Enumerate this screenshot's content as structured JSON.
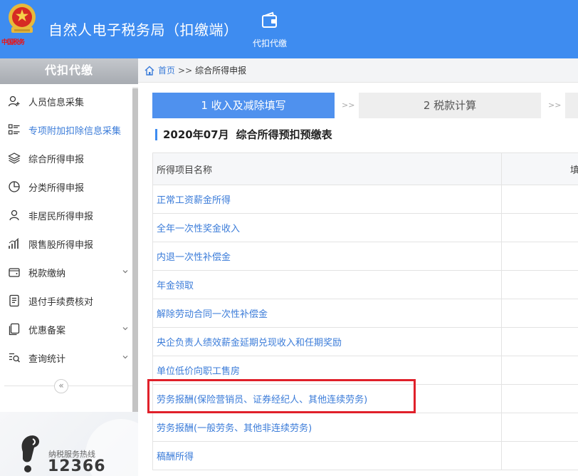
{
  "header": {
    "title": "自然人电子税务局（扣缴端）",
    "emblem_caption": "中国税务",
    "nav": [
      {
        "label": "代扣代缴",
        "icon": "wallet-icon"
      }
    ]
  },
  "sidebar": {
    "title": "代扣代缴",
    "items": [
      {
        "label": "人员信息采集",
        "icon": "person-add-icon",
        "expandable": false
      },
      {
        "label": "专项附加扣除信息采集",
        "icon": "list-icon",
        "expandable": false,
        "active": true
      },
      {
        "label": "综合所得申报",
        "icon": "layers-icon",
        "expandable": false
      },
      {
        "label": "分类所得申报",
        "icon": "pie-chart-icon",
        "expandable": false
      },
      {
        "label": "非居民所得申报",
        "icon": "person-icon",
        "expandable": false
      },
      {
        "label": "限售股所得申报",
        "icon": "bar-chart-icon",
        "expandable": false
      },
      {
        "label": "税款缴纳",
        "icon": "wallet-icon",
        "expandable": true
      },
      {
        "label": "退付手续费核对",
        "icon": "document-icon",
        "expandable": false
      },
      {
        "label": "优惠备案",
        "icon": "copy-icon",
        "expandable": true
      },
      {
        "label": "查询统计",
        "icon": "search-list-icon",
        "expandable": true
      }
    ],
    "collapse_glyph": "«",
    "hotline": {
      "label": "纳税服务热线",
      "number": "12366"
    }
  },
  "breadcrumb": {
    "home": "首页",
    "separator": ">>",
    "current": "综合所得申报"
  },
  "steps": [
    {
      "label": "1 收入及减除填写",
      "active": true
    },
    {
      "label": "2 税款计算",
      "active": false
    },
    {
      "label": "",
      "active": false
    }
  ],
  "step_separator": ">>",
  "section": {
    "period": "2020年07月",
    "title": "综合所得预扣预缴表"
  },
  "table": {
    "headers": {
      "name": "所得项目名称",
      "fill": "填"
    },
    "rows": [
      "正常工资薪金所得",
      "全年一次性奖金收入",
      "内退一次性补偿金",
      "年金领取",
      "解除劳动合同一次性补偿金",
      "央企负责人绩效薪金延期兑现收入和任期奖励",
      "单位低价向职工售房",
      "劳务报酬(保险营销员、证券经纪人、其他连续劳务)",
      "劳务报酬(一般劳务、其他非连续劳务)",
      "稿酬所得"
    ],
    "highlighted_row": 7
  },
  "colors": {
    "header_bg": "#3e8cf0",
    "link": "#3b7cd9",
    "step_active": "#4f91ee",
    "highlight": "#e0202a"
  }
}
